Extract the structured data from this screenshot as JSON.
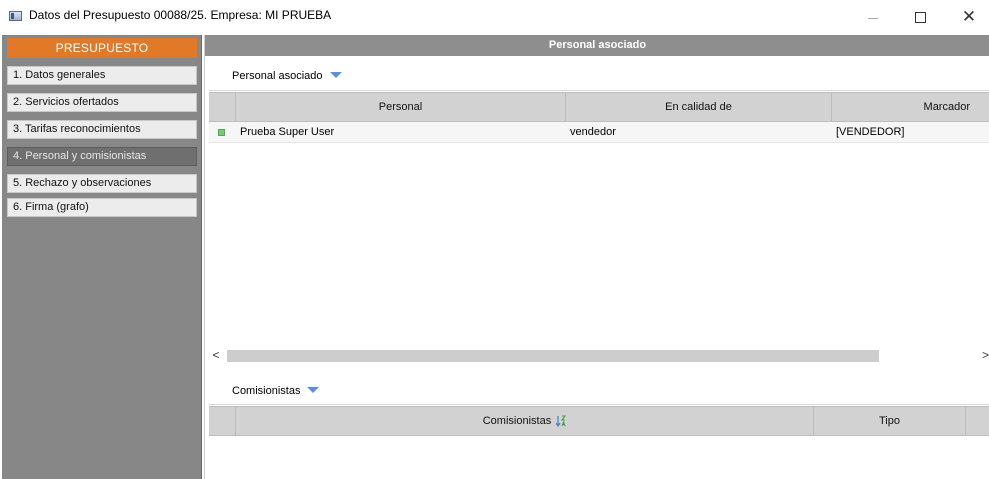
{
  "window": {
    "title": "Datos del Presupuesto 00088/25.  Empresa: MI PRUEBA",
    "icons": [
      "app-icon",
      "minimize-icon",
      "maximize-icon",
      "close-icon"
    ]
  },
  "sidebar": {
    "header": "PRESUPUESTO",
    "items": [
      {
        "label": "1. Datos generales",
        "active": false
      },
      {
        "label": "2. Servicios ofertados",
        "active": false
      },
      {
        "label": "3. Tarifas reconocimientos",
        "active": false
      },
      {
        "label": "4. Personal y comisionistas",
        "active": true
      },
      {
        "label": "5. Rechazo y observaciones",
        "active": false
      },
      {
        "label": "6. Firma (grafo)",
        "active": false
      }
    ]
  },
  "main": {
    "section_title": "Personal asociado",
    "personal_group": {
      "label": "Personal asociado",
      "columns": [
        "Personal",
        "En calidad de",
        "Marcador"
      ],
      "rows": [
        {
          "personal": "Prueba Super User",
          "calidad": "vendedor",
          "marcador": "[VENDEDOR]"
        }
      ]
    },
    "comisionistas_group": {
      "label": "Comisionistas",
      "columns": [
        "Comisionistas",
        "Tipo"
      ]
    },
    "scroll": {
      "left": "<",
      "right": ">"
    }
  },
  "colors": {
    "accent_orange": "#e07a28",
    "sidebar_bg": "#878787",
    "active_item": "#6f6f6f",
    "section_header": "#8e8e8e",
    "caret_blue": "#5b8fe0",
    "row_marker_green": "#7dc67d"
  }
}
